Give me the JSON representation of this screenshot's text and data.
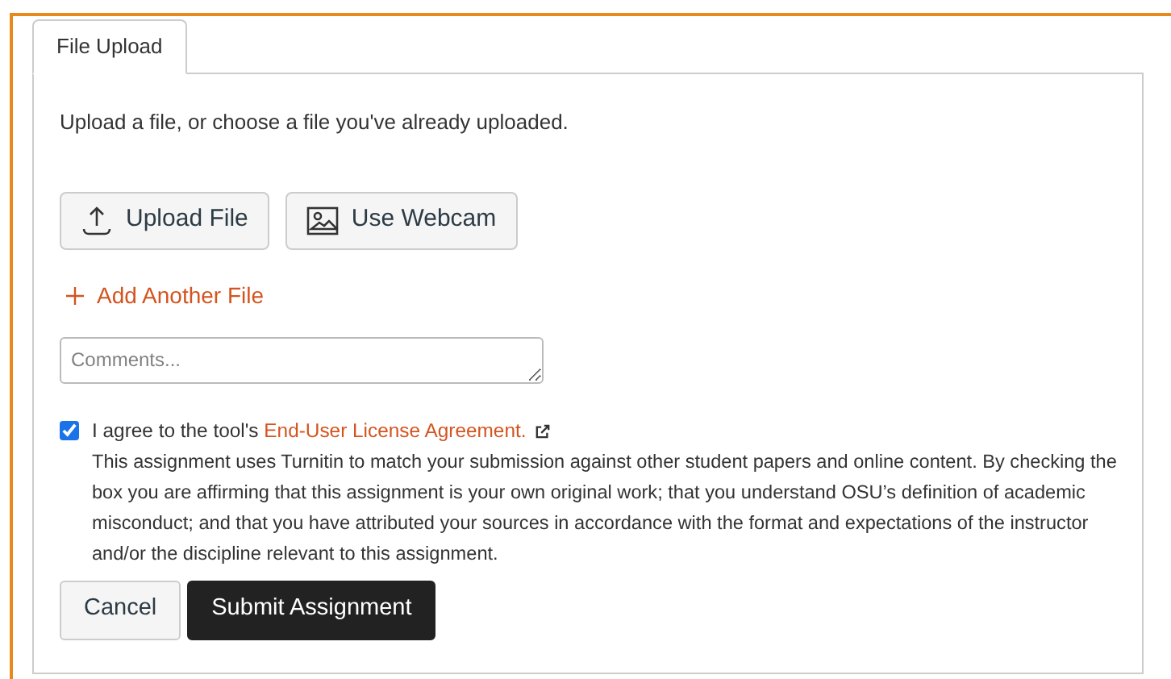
{
  "tabs": [
    {
      "label": "File Upload",
      "selected": true
    }
  ],
  "instructions": "Upload a file, or choose a file you've already uploaded.",
  "file_buttons": [
    {
      "kind": "upload",
      "label": "Upload File"
    },
    {
      "kind": "webcam",
      "label": "Use Webcam"
    }
  ],
  "add_file": "Add Another File",
  "comments": {
    "placeholder": "Comments..."
  },
  "agreement": {
    "checked": true,
    "prefix": "I agree to the tool's",
    "link": "End-User License Agreement.",
    "description": "This assignment uses Turnitin to match your submission against other student papers and online content. By checking the box you are affirming that this assignment is your own original work; that you understand OSU’s definition of academic misconduct; and that you have attributed your sources in accordance with the format and expectations of the instructor and/or the discipline relevant to this assignment."
  },
  "actions": [
    {
      "kind": "secondary",
      "label": "Cancel"
    },
    {
      "kind": "primary",
      "label": "Submit Assignment"
    }
  ]
}
